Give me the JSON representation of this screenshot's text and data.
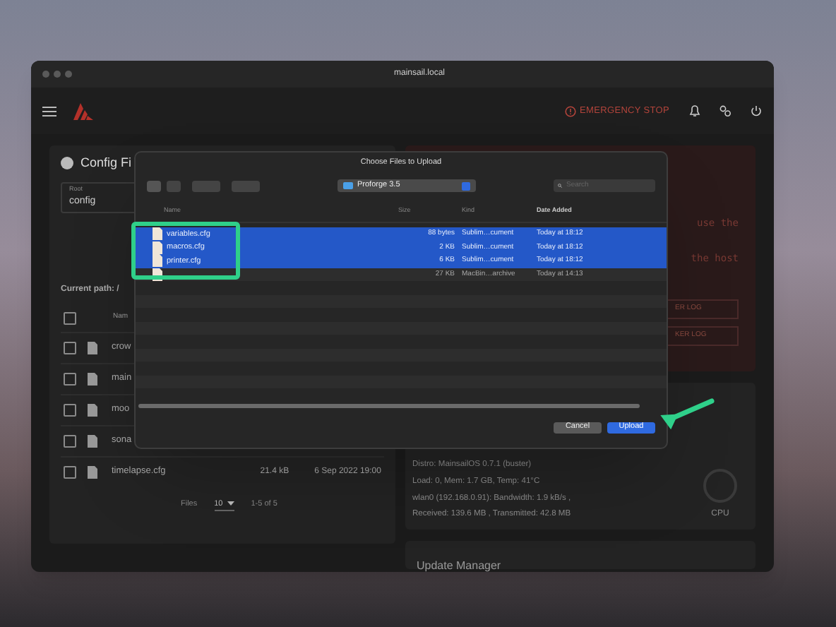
{
  "browser": {
    "url": "mainsail.local"
  },
  "header": {
    "emergency_stop": "EMERGENCY STOP"
  },
  "config_files": {
    "title": "Config Fi",
    "root_label": "Root",
    "root_value": "config",
    "current_path": "Current path: /",
    "name_column": "Nam",
    "all_checked": false,
    "rows": [
      {
        "name": "crow",
        "checked": false
      },
      {
        "name": "main",
        "checked": false
      },
      {
        "name": "moo",
        "checked": false
      },
      {
        "name": "sona",
        "checked": false
      },
      {
        "name": "timelapse.cfg",
        "size": "21.4 kB",
        "modified": "6 Sep 2022 19:00",
        "checked": false
      }
    ],
    "footer": {
      "files_label": "Files",
      "per_page": "10",
      "range": "1-5 of 5"
    }
  },
  "console": {
    "lines": [
      "use the",
      "the host"
    ],
    "buttons": [
      "ER LOG",
      "KER LOG"
    ]
  },
  "system": {
    "lines": [
      "Distro: MainsailOS 0.7.1 (buster)",
      "Load: 0, Mem: 1.7 GB, Temp: 41°C",
      "wlan0 (192.168.0.91): Bandwidth: 1.9 kB/s ,",
      "Received: 139.6 MB , Transmitted: 42.8 MB"
    ],
    "gauge_label": "CPU"
  },
  "update_manager": {
    "title": "Update Manager"
  },
  "dialog": {
    "title": "Choose Files to Upload",
    "folder": "Proforge 3.5",
    "search_placeholder": "Search",
    "columns": [
      "Name",
      "Size",
      "Kind",
      "Date Added"
    ],
    "files": [
      {
        "name": "variables.cfg",
        "size": "88 bytes",
        "kind": "Sublim…cument",
        "date": "Today at 18:12",
        "selected": true
      },
      {
        "name": "macros.cfg",
        "size": "2 KB",
        "kind": "Sublim…cument",
        "date": "Today at 18:12",
        "selected": true
      },
      {
        "name": "printer.cfg",
        "size": "6 KB",
        "kind": "Sublim…cument",
        "date": "Today at 18:12",
        "selected": true
      },
      {
        "size": "27 KB",
        "kind": "MacBin…archive",
        "date": "Today at 14:13",
        "selected": false
      }
    ],
    "buttons": {
      "cancel": "Cancel",
      "upload": "Upload"
    }
  }
}
